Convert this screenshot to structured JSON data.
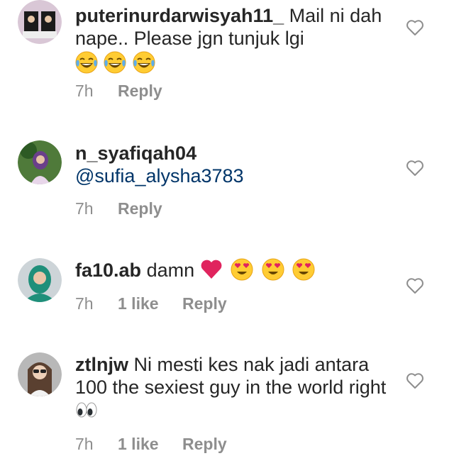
{
  "comments": [
    {
      "username": "puterinurdarwisyah11_",
      "text": "Mail ni dah nape.. Please jgn tunjuk lgi",
      "emojis": [
        "face-with-tears-of-joy",
        "face-with-tears-of-joy",
        "face-with-tears-of-joy"
      ],
      "time": "7h",
      "likes": "",
      "reply_label": "Reply"
    },
    {
      "username": "n_syafiqah04",
      "mention": "@sufia_alysha3783",
      "time": "7h",
      "likes": "",
      "reply_label": "Reply"
    },
    {
      "username": "fa10.ab",
      "text": "damn",
      "emojis": [
        "red-heart",
        "smiling-face-with-heart-eyes",
        "smiling-face-with-heart-eyes",
        "smiling-face-with-heart-eyes"
      ],
      "time": "7h",
      "likes": "1 like",
      "reply_label": "Reply"
    },
    {
      "username": "ztlnjw",
      "text": "Ni mesti kes nak jadi antara 100 the sexiest guy in the world right",
      "emojis": [
        "eyes"
      ],
      "time": "7h",
      "likes": "1 like",
      "reply_label": "Reply"
    }
  ],
  "colors": {
    "text": "#262626",
    "meta": "#8e8e8e",
    "mention": "#003569"
  }
}
